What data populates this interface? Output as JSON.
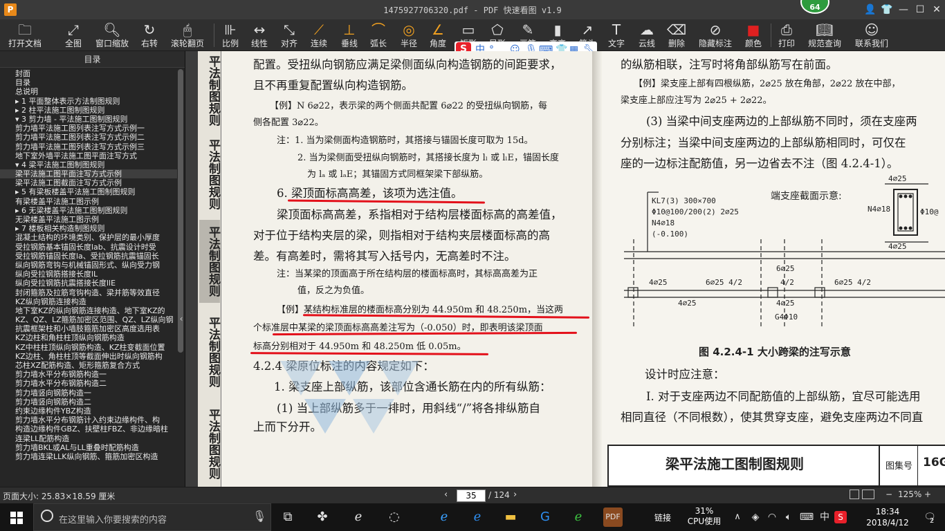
{
  "window": {
    "logo": "P",
    "title": "1475927706320.pdf - PDF 快速看图 v1.9",
    "badge": "64",
    "controls": [
      "user-icon",
      "shirt-icon",
      "minimize",
      "maximize",
      "close"
    ]
  },
  "toolbar": {
    "items": [
      {
        "label": "打开文档",
        "icon": "folder-icon"
      },
      {
        "label": "全图",
        "icon": "fit-icon"
      },
      {
        "label": "窗口缩放",
        "icon": "zoom-icon"
      },
      {
        "label": "右转",
        "icon": "rotate-icon"
      },
      {
        "label": "滚轮翻页",
        "icon": "mouse-icon"
      },
      {
        "label": "比例",
        "icon": "scale-icon"
      },
      {
        "label": "线性",
        "icon": "linear-icon"
      },
      {
        "label": "对齐",
        "icon": "align-icon"
      },
      {
        "label": "连续",
        "icon": "continuous-icon"
      },
      {
        "label": "垂线",
        "icon": "perpendicular-icon"
      },
      {
        "label": "弧长",
        "icon": "arc-icon"
      },
      {
        "label": "半径",
        "icon": "radius-icon"
      },
      {
        "label": "角度",
        "icon": "angle-icon"
      },
      {
        "label": "矩形",
        "icon": "rect-icon"
      },
      {
        "label": "异形",
        "icon": "shape-icon"
      },
      {
        "label": "画笔",
        "icon": "pen-icon"
      },
      {
        "label": "高亮",
        "icon": "highlight-icon"
      },
      {
        "label": "箭头",
        "icon": "arrow-icon"
      },
      {
        "label": "文字",
        "icon": "text-icon"
      },
      {
        "label": "云线",
        "icon": "cloud-icon"
      },
      {
        "label": "删除",
        "icon": "eraser-icon"
      },
      {
        "label": "隐藏标注",
        "icon": "hide-icon"
      },
      {
        "label": "颜色",
        "icon": "color-icon"
      },
      {
        "label": "打印",
        "icon": "print-icon"
      },
      {
        "label": "规范查询",
        "icon": "book-icon"
      },
      {
        "label": "联系我们",
        "icon": "contact-icon"
      }
    ],
    "ime": {
      "logo": "S",
      "text": "中",
      "punct": "°,"
    }
  },
  "sidebar": {
    "title": "目录",
    "items": [
      "封面",
      "目录",
      "总说明",
      "▸ 1 平面整体表示方法制图规则",
      "▸ 2 柱平法施工图制图规则",
      "▾ 3 剪力墙 - 平法施工图制图规则",
      "  剪力墙平法施工图列表注写方式示例一",
      "  剪力墙平法施工图列表注写方式示例二",
      "  剪力墙平法施工图列表注写方式示例三",
      "  地下室外墙平法施工图平面注写方式",
      "▾ 4 梁平法施工图制图规则",
      "  梁平法施工图平面注写方式示例",
      "  梁平法施工图截面注写方式示例",
      "▸ 5 有梁板楼盖平法施工图制图规则",
      "  有梁楼盖平法施工图示例",
      "▸ 6 无梁楼盖平法施工图制图规则",
      "  无梁楼盖平法施工图示例",
      "▸ 7 楼板相关构造制图规则",
      "混凝土结构的环境类别、保护层的最小厚度",
      "受拉钢筋基本锚固长度lab、抗震设计时受",
      "受拉钢筋锚固长度la、受拉钢筋抗震锚固长",
      "纵向钢筋弯钩与机械锚固形式、纵向受力钢",
      "纵向受拉钢筋搭接长度lL",
      "纵向受拉钢筋抗震搭接长度llE",
      "封闭箍筋及拉筋弯钩构造、梁并筋等效直径",
      "KZ纵向钢筋连接构造",
      "地下室KZ的纵向钢筋连接构造、地下室KZ的",
      "KZ、QZ、LZ箍筋加密区范围、QZ、LZ纵向钢",
      "抗震框架柱和小墙肢箍筋加密区高度选用表",
      "KZ边柱和角柱柱顶纵向钢筋构造",
      "KZ中柱柱顶纵向钢筋构造、KZ柱变截面位置",
      "KZ边柱、角柱柱顶等截面伸出时纵向钢筋构",
      "芯柱XZ配筋构造、矩形箍筋复合方式",
      "剪力墙水平分布钢筋构造一",
      "剪力墙水平分布钢筋构造二",
      "剪力墙竖向钢筋构造一",
      "剪力墙竖向钢筋构造二",
      "约束边缘构件YBZ构造",
      "剪力墙水平分布钢筋计入约束边缘构件、构",
      "构造边缘构件GBZ、扶壁柱FBZ、非边缘暗柱",
      "连梁LL配筋构造",
      "剪力墙BKL或AL与LL重叠时配筋构造",
      "剪力墙连梁LLK纵向钢筋、箍筋加密区构造"
    ],
    "active_index": 11
  },
  "document": {
    "side_tabs": [
      "平法制图规则",
      "平法制图规则",
      "平法制图规则",
      "平法制图规则",
      "平法制图规则"
    ],
    "left_lines": [
      {
        "text": "配置。受扭纵向钢筋应满足梁侧面纵向构造钢筋的间距要求，",
        "cls": "big"
      },
      {
        "text": "且不再重复配置纵向构造钢筋。",
        "cls": "big"
      },
      {
        "text": "【例】N 6⌀22，表示梁的两个侧面共配置 6⌀22 的受扭纵向钢筋，每",
        "cls": "small"
      },
      {
        "text": "侧各配置 3⌀22。",
        "cls": "small"
      },
      {
        "text": "注：1. 当为梁侧面构造钢筋时，其搭接与锚固长度可取为 15d。",
        "cls": "small"
      },
      {
        "text": "2. 当为梁侧面受扭纵向钢筋时，其搭接长度为 lₗ 或 lₗE，锚固长度",
        "cls": "small"
      },
      {
        "text": "为 lₐ 或 lₐE；其锚固方式同框架梁下部纵筋。",
        "cls": "small"
      },
      {
        "text": "6. 梁顶面标高高差，该项为选注值。",
        "cls": "big"
      },
      {
        "text": "梁顶面标高高差，系指相对于结构层楼面标高的高差值，",
        "cls": "big"
      },
      {
        "text": "对于位于结构夹层的梁，则指相对于结构夹层楼面标高的高",
        "cls": "big"
      },
      {
        "text": "差。有高差时，需将其写入括号内，无高差时不注。",
        "cls": "big"
      },
      {
        "text": "注：当某梁的顶面高于所在结构层的楼面标高时，其标高高差为正",
        "cls": "small"
      },
      {
        "text": "值，反之为负值。",
        "cls": "small"
      },
      {
        "text": "【例】某结构标准层的楼面标高分别为 44.950m 和 48.250m，当这两",
        "cls": "small"
      },
      {
        "text": "个标准层中某梁的梁顶面标高高差注写为（-0.050）时，即表明该梁顶面",
        "cls": "small"
      },
      {
        "text": "标高分别相对于 44.950m 和 48.250m 低 0.05m。",
        "cls": "small"
      },
      {
        "text": "4.2.4 梁原位标注的内容规定如下：",
        "cls": "big"
      },
      {
        "text": "1. 梁支座上部纵筋，该部位含通长筋在内的所有纵筋：",
        "cls": "big"
      },
      {
        "text": "(1) 当上部纵筋多于一排时，用斜线“/”将各排纵筋自",
        "cls": "big"
      },
      {
        "text": "上而下分开。",
        "cls": "big"
      }
    ],
    "right_lines": [
      {
        "text": "的纵筋相联，注写时将角部纵筋写在前面。",
        "cls": "big"
      },
      {
        "text": "【例】梁支座上部有四根纵筋，2⌀25 放在角部，2⌀22 放在中部，",
        "cls": "small"
      },
      {
        "text": "梁支座上部应注写为 2⌀25 + 2⌀22。",
        "cls": "small"
      },
      {
        "text": "(3) 当梁中间支座两边的上部纵筋不同时，须在支座两",
        "cls": "big"
      },
      {
        "text": "分别标注；当梁中间支座两边的上部纵筋相同时，可仅在",
        "cls": "big"
      },
      {
        "text": "座的一边标注配筋值，另一边省去不注（图 4.2.4-1）。",
        "cls": "big"
      }
    ],
    "diagram": {
      "section_label": "端支座截面示意:",
      "beam_label": [
        "KL7(3) 300×700",
        "Φ10@100/200(2) 2⌀25",
        "N4⌀18",
        "(-0.100)"
      ],
      "top_left": "4⌀25",
      "n_label": "N4⌀18",
      "phi_label": "Φ10@",
      "bottom_small": "4⌀25",
      "span_labels": [
        "4⌀25",
        "6⌀25 4/2",
        "6⌀25 4/2",
        "6⌀25 4/2",
        "4⌀25"
      ],
      "mid_top": "6⌀25",
      "mid_frac": "4/2",
      "bottom_labels": [
        "4⌀25",
        "4⌀25",
        "G4Φ10"
      ],
      "caption": "图 4.2.4-1  大小跨梁的注写示意"
    },
    "right_after": [
      {
        "text": "设计时应注意：",
        "cls": "big"
      },
      {
        "text": "Ⅰ. 对于支座两边不同配筋值的上部纵筋，宜尽可能选用",
        "cls": "big"
      },
      {
        "text": "相同直径（不同根数），使其贯穿支座，避免支座两边不同直",
        "cls": "big"
      }
    ],
    "footer_title": "梁平法施工图制图规则",
    "footer_label": "图集号",
    "footer_num": "16G"
  },
  "status": {
    "page_size": "页面大小: 25.83×18.59 厘米",
    "page_current": "35",
    "page_total": "/ 124",
    "zoom": "125%"
  },
  "taskbar": {
    "search_placeholder": "在这里输入你要搜索的内容",
    "link_label": "链接",
    "cpu_percent": "31%",
    "cpu_label": "CPU使用",
    "ime": "中",
    "time": "18:34",
    "date": "2018/4/12",
    "notifications": "2"
  },
  "colors": {
    "accent_orange": "#e8891a",
    "annotation_red": "#e3101a",
    "badge_green": "#2e9b3e"
  }
}
